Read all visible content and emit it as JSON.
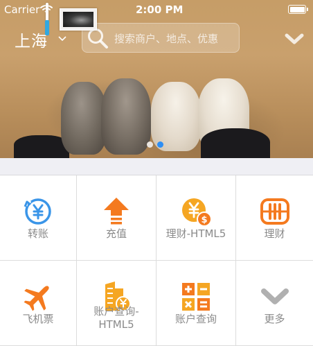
{
  "status_bar": {
    "carrier": "Carrier",
    "time": "2:00 PM"
  },
  "header": {
    "city": "上海",
    "search": {
      "placeholder": "搜索商户、地点、优惠"
    }
  },
  "banner": {
    "page_count": 2,
    "active_page": 2
  },
  "grid": {
    "items": [
      {
        "label": "转账",
        "icon": "transfer-yuan-icon",
        "color": "#3a95e8"
      },
      {
        "label": "充值",
        "icon": "recharge-upload-icon",
        "color": "#f47a1f"
      },
      {
        "label": "理财-HTML5",
        "icon": "finance-coins-icon",
        "color": "#f5a623"
      },
      {
        "label": "理财",
        "icon": "abacus-icon",
        "color": "#f47a1f"
      },
      {
        "label": "飞机票",
        "icon": "airplane-icon",
        "color": "#f47a1f"
      },
      {
        "label": "账户查询-\nHTML5",
        "icon": "account-building-icon",
        "color": "#f5a623"
      },
      {
        "label": "账户查询",
        "icon": "calculator-icon",
        "color": "#f47a1f"
      },
      {
        "label": "更多",
        "icon": "chevron-down-icon",
        "color": "#b0b0b0"
      }
    ]
  },
  "colors": {
    "accent": "#2d8ef4",
    "label_text": "#8a8a8a",
    "divider": "#dcdcdc"
  }
}
